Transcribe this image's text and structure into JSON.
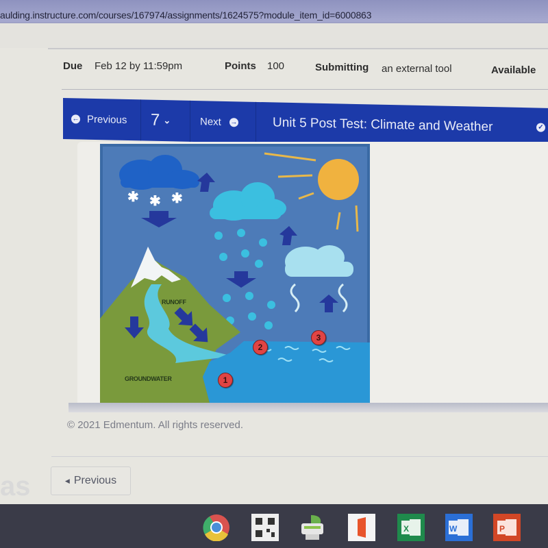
{
  "browser": {
    "url": "aulding.instructure.com/courses/167974/assignments/1624575?module_item_id=6000863"
  },
  "assignment_meta": {
    "due_label": "Due",
    "due_value": "Feb 12 by 11:59pm",
    "points_label": "Points",
    "points_value": "100",
    "submitting_label": "Submitting",
    "submitting_value": "an external tool",
    "available_label": "Available"
  },
  "nav": {
    "previous_label": "Previous",
    "question_number": "7",
    "next_label": "Next",
    "title": "Unit 5 Post Test: Climate and Weather"
  },
  "diagram": {
    "description": "Water cycle illustration",
    "labels": {
      "runoff": "RUNOFF",
      "groundwater": "GROUNDWATER"
    },
    "markers": [
      {
        "label": "1"
      },
      {
        "label": "2"
      },
      {
        "label": "3"
      }
    ],
    "colors": {
      "sky": "#4d7bb8",
      "sun": "#f0b23f",
      "land": "#7a9a3c",
      "water": "#2a97d6",
      "river": "#5cc9dd",
      "arrow": "#25389c",
      "marker": "#e04444"
    }
  },
  "footer": {
    "copyright": "© 2021 Edmentum. All rights reserved.",
    "previous_button": "Previous"
  },
  "taskbar": {
    "apps": [
      "chrome-icon",
      "qr-code-icon",
      "printer-icon",
      "office-icon",
      "excel-icon",
      "word-icon",
      "powerpoint-icon"
    ]
  }
}
